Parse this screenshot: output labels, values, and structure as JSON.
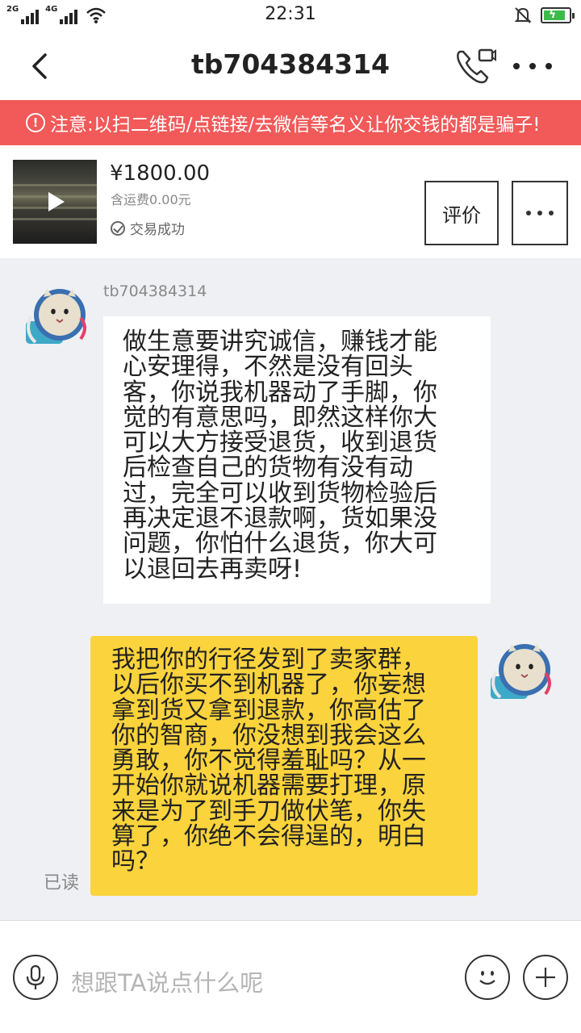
{
  "status_bar": {
    "network_1": "2G",
    "network_2": "4G",
    "time": "22:31",
    "icons": [
      "signal-icon",
      "wifi-icon",
      "mute-bell-icon",
      "battery-charging-icon"
    ]
  },
  "header": {
    "title": "tb704384314",
    "icons": [
      "back-arrow-icon",
      "phone-video-icon",
      "more-dots-icon"
    ]
  },
  "warning": {
    "text": "注意:以扫二维码/点链接/去微信等名义让你交钱的都是骗子!",
    "icon_label": "!"
  },
  "product": {
    "price": "¥1800.00",
    "shipping": "含运费0.00元",
    "status": "交易成功",
    "review_label": "评价"
  },
  "chat": {
    "sender_name": "tb704384314",
    "incoming_lines": [
      "做生意要讲究诚信，赚钱才能",
      "心安理得，不然是没有回头",
      "客，你说我机器动了手脚，你",
      "觉的有意思吗，即然这样你大",
      "可以大方接受退货，收到退货",
      "后检查自己的货物有没有动",
      "过，完全可以收到货物检验后",
      "再决定退不退款啊，货如果没",
      "问题，你怕什么退货，你大可",
      "以退回去再卖呀!"
    ],
    "outgoing_lines": [
      "我把你的行径发到了卖家群，",
      "以后你买不到机器了，你妄想",
      "拿到货又拿到退款，你高估了",
      "你的智商，你没想到我会这么",
      "勇敢，你不觉得羞耻吗？从一",
      "开始你就说机器需要打理，原",
      "来是为了到手刀做伏笔，你失",
      "算了，你绝不会得逞的，明白",
      "吗？"
    ],
    "read_receipt": "已读"
  },
  "input_bar": {
    "placeholder": "想跟TA说点什么呢"
  },
  "colors": {
    "warning_bg": "#f25959",
    "outgoing_bubble": "#fbd33c",
    "incoming_bubble": "#ffffff",
    "chat_bg": "#eef0f3",
    "battery": "#3cba4a"
  }
}
